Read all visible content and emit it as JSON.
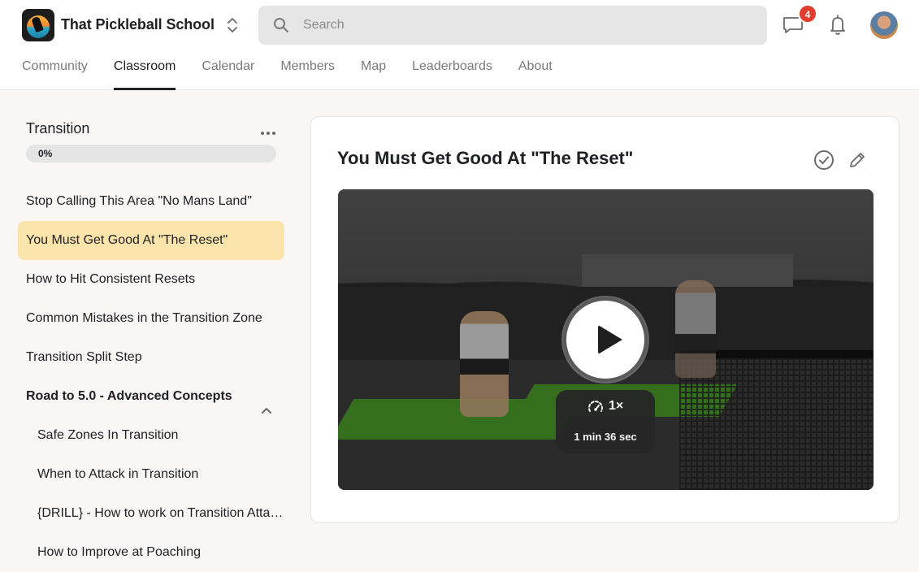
{
  "header": {
    "group_name": "That Pickleball School",
    "search_placeholder": "Search",
    "chat_badge": "4"
  },
  "nav": {
    "tabs": [
      {
        "label": "Community",
        "active": false
      },
      {
        "label": "Classroom",
        "active": true
      },
      {
        "label": "Calendar",
        "active": false
      },
      {
        "label": "Members",
        "active": false
      },
      {
        "label": "Map",
        "active": false
      },
      {
        "label": "Leaderboards",
        "active": false
      },
      {
        "label": "About",
        "active": false
      }
    ]
  },
  "sidebar": {
    "course_title": "Transition",
    "progress_label": "0%",
    "progress_value": 0,
    "lessons": [
      {
        "label": "Stop Calling This Area \"No Mans Land\""
      },
      {
        "label": "You Must Get Good At \"The Reset\"",
        "active": true
      },
      {
        "label": "How to Hit Consistent Resets"
      },
      {
        "label": "Common Mistakes in the Transition Zone"
      },
      {
        "label": "Transition Split Step"
      }
    ],
    "section": {
      "label": "Road to 5.0 - Advanced Concepts",
      "expanded": true,
      "lessons": [
        {
          "label": "Safe Zones In Transition"
        },
        {
          "label": "When to Attack in Transition"
        },
        {
          "label": "{DRILL} - How to work on Transition Atta…"
        },
        {
          "label": "How to Improve at Poaching"
        }
      ]
    }
  },
  "content": {
    "title": "You Must Get Good At \"The Reset\"",
    "video": {
      "speed": "1×",
      "duration": "1 min 36 sec"
    }
  },
  "colors": {
    "active_lesson_bg": "#fbe4ab",
    "badge": "#e23d2f",
    "court_green": "#4a9a2a"
  },
  "icons": [
    "app-logo",
    "switcher-icon",
    "search-icon",
    "chat-icon",
    "bell-icon",
    "more-icon",
    "chevron-up-icon",
    "check-circle-icon",
    "edit-icon",
    "play-icon",
    "speed-icon"
  ]
}
